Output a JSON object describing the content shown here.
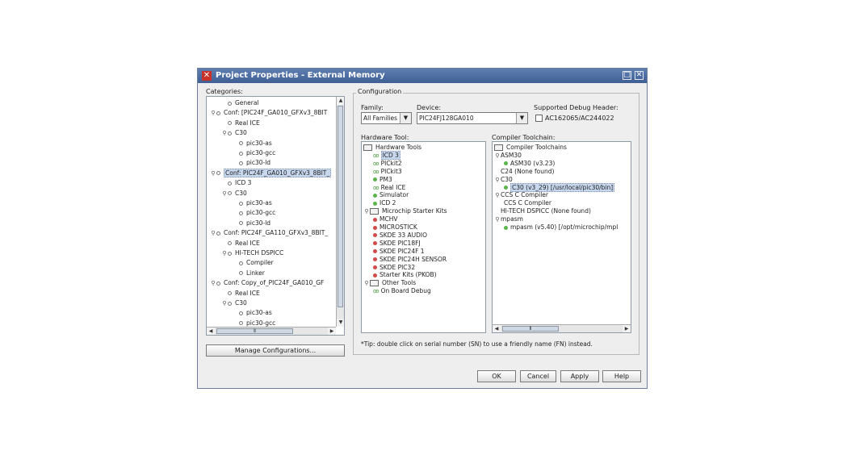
{
  "window": {
    "title": "Project Properties - External Memory",
    "app_icon": "x-mark-icon",
    "maximize_symbol": "□",
    "close_symbol": "✕"
  },
  "categories": {
    "label": "Categories:",
    "items": [
      {
        "text": "General",
        "level": 1,
        "toggle": ""
      },
      {
        "text": "Conf: [PIC24F_GA010_GFXv3_8BIT",
        "level": 0,
        "toggle": "o"
      },
      {
        "text": "Real ICE",
        "level": 1,
        "toggle": ""
      },
      {
        "text": "C30",
        "level": 1,
        "toggle": "o"
      },
      {
        "text": "pic30-as",
        "level": 2,
        "toggle": ""
      },
      {
        "text": "pic30-gcc",
        "level": 2,
        "toggle": ""
      },
      {
        "text": "pic30-ld",
        "level": 2,
        "toggle": ""
      },
      {
        "text": "Conf: PIC24F_GA010_GFXv3_8BIT_",
        "level": 0,
        "toggle": "o",
        "selected": true
      },
      {
        "text": "ICD 3",
        "level": 1,
        "toggle": ""
      },
      {
        "text": "C30",
        "level": 1,
        "toggle": "o"
      },
      {
        "text": "pic30-as",
        "level": 2,
        "toggle": ""
      },
      {
        "text": "pic30-gcc",
        "level": 2,
        "toggle": ""
      },
      {
        "text": "pic30-ld",
        "level": 2,
        "toggle": ""
      },
      {
        "text": "Conf: PIC24F_GA110_GFXv3_8BIT_",
        "level": 0,
        "toggle": "o"
      },
      {
        "text": "Real ICE",
        "level": 1,
        "toggle": ""
      },
      {
        "text": "HI-TECH DSPICC",
        "level": 1,
        "toggle": "o"
      },
      {
        "text": "Compiler",
        "level": 2,
        "toggle": ""
      },
      {
        "text": "Linker",
        "level": 2,
        "toggle": ""
      },
      {
        "text": "Conf: Copy_of_PIC24F_GA010_GF",
        "level": 0,
        "toggle": "o"
      },
      {
        "text": "Real ICE",
        "level": 1,
        "toggle": ""
      },
      {
        "text": "C30",
        "level": 1,
        "toggle": "o"
      },
      {
        "text": "pic30-as",
        "level": 2,
        "toggle": ""
      },
      {
        "text": "pic30-gcc",
        "level": 2,
        "toggle": ""
      }
    ],
    "manage_button": "Manage Configurations..."
  },
  "configuration": {
    "label": "Configuration",
    "family_label": "Family:",
    "family_value": "All Families",
    "device_label": "Device:",
    "device_value": "PIC24FJ128GA010",
    "debug_header_label": "Supported Debug Header:",
    "debug_header_value": "AC162065/AC244022",
    "hardware_label": "Hardware Tool:",
    "hardware_tree": [
      {
        "text": "Hardware Tools",
        "kind": "folder",
        "level": 0,
        "toggle": ""
      },
      {
        "text": "ICD 3",
        "kind": "gg",
        "level": 1,
        "selected": true
      },
      {
        "text": "PICkit2",
        "kind": "gg",
        "level": 1
      },
      {
        "text": "PICkit3",
        "kind": "gg",
        "level": 1
      },
      {
        "text": "PM3",
        "kind": "green",
        "level": 1
      },
      {
        "text": "Real ICE",
        "kind": "gg",
        "level": 1
      },
      {
        "text": "Simulator",
        "kind": "green",
        "level": 1
      },
      {
        "text": "ICD 2",
        "kind": "green",
        "level": 1
      },
      {
        "text": "Microchip Starter Kits",
        "kind": "folder",
        "level": 0,
        "toggle": "o"
      },
      {
        "text": "MCHV",
        "kind": "red",
        "level": 1
      },
      {
        "text": "MICROSTICK",
        "kind": "red",
        "level": 1
      },
      {
        "text": "SKDE 33 AUDIO",
        "kind": "red",
        "level": 1
      },
      {
        "text": "SKDE PIC18FJ",
        "kind": "red",
        "level": 1
      },
      {
        "text": "SKDE PIC24F 1",
        "kind": "red",
        "level": 1
      },
      {
        "text": "SKDE PIC24H SENSOR",
        "kind": "red",
        "level": 1
      },
      {
        "text": "SKDE PIC32",
        "kind": "red",
        "level": 1
      },
      {
        "text": "Starter Kits (PKOB)",
        "kind": "red",
        "level": 1
      },
      {
        "text": "Other Tools",
        "kind": "folder",
        "level": 0,
        "toggle": "o"
      },
      {
        "text": "On Board Debug",
        "kind": "gg",
        "level": 1
      }
    ],
    "compiler_label": "Compiler Toolchain:",
    "compiler_tree": [
      {
        "text": "Compiler Toolchains",
        "kind": "folder",
        "level": 0
      },
      {
        "text": "ASM30",
        "kind": "none",
        "level": 0,
        "toggle": "o"
      },
      {
        "text": "ASM30 (v3.23)",
        "kind": "green",
        "level": 1
      },
      {
        "text": "C24 (None found)",
        "kind": "none",
        "level": 0
      },
      {
        "text": "C30",
        "kind": "none",
        "level": 0,
        "toggle": "o"
      },
      {
        "text": "C30 (v3_29) [/usr/local/pic30/bin]",
        "kind": "green",
        "level": 1,
        "selected": true
      },
      {
        "text": "CCS C Compiler",
        "kind": "none",
        "level": 0,
        "toggle": "o"
      },
      {
        "text": "CCS C Compiler",
        "kind": "none",
        "level": 1
      },
      {
        "text": "HI-TECH DSPICC (None found)",
        "kind": "none",
        "level": 0
      },
      {
        "text": "mpasm",
        "kind": "none",
        "level": 0,
        "toggle": "o"
      },
      {
        "text": "mpasm (v5.40) [/opt/microchip/mpl",
        "kind": "green",
        "level": 1
      }
    ],
    "tip": "*Tip: double click on serial number (SN) to use a friendly name (FN) instead."
  },
  "buttons": {
    "ok": "OK",
    "cancel": "Cancel",
    "apply": "Apply",
    "help": "Help"
  },
  "scroll": {
    "up": "▲",
    "down": "▼",
    "left": "◀",
    "right": "▶",
    "grip": "⦀"
  }
}
